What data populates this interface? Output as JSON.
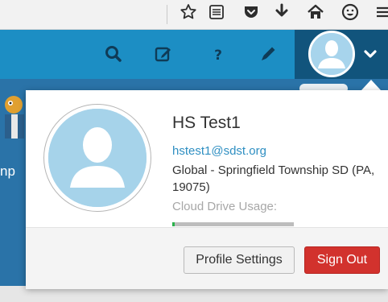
{
  "colors": {
    "header": "#1c8ec4",
    "user_area": "#11547c",
    "sign_out": "#d2322d",
    "link": "#2f8fc2",
    "avatar": "#a6d3ea",
    "usage_fill": "#2bb24c"
  },
  "browser_toolbar": {
    "icons": [
      "star-icon",
      "reader-list-icon",
      "pocket-icon",
      "download-icon",
      "home-icon",
      "smiley-icon",
      "menu-icon"
    ]
  },
  "app_header": {
    "icons": [
      "search-icon",
      "compose-icon",
      "help-icon",
      "pencil-icon"
    ],
    "user_menu_icon": "chevron-down-icon"
  },
  "background": {
    "partial_text": "np"
  },
  "profile": {
    "name": "HS Test1",
    "email": "hstest1@sdst.org",
    "organization": "Global - Springfield Township SD (PA, 19075)",
    "cloud_drive_label": "Cloud Drive Usage:",
    "cloud_drive_usage_fraction": 0.02
  },
  "actions": {
    "profile_settings": "Profile Settings",
    "sign_out": "Sign Out"
  }
}
